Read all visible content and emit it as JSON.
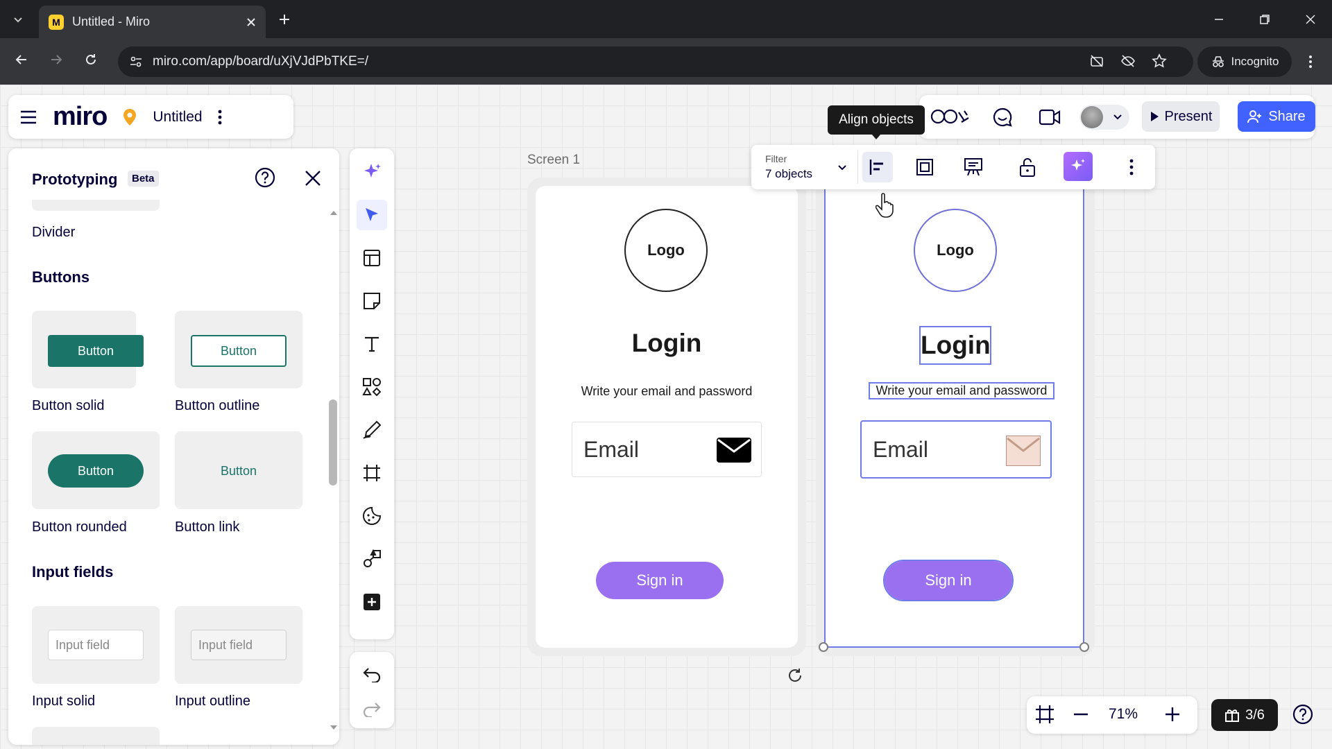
{
  "browser": {
    "tab_title": "Untitled - Miro",
    "url": "miro.com/app/board/uXjVJdPbTKE=/",
    "incognito_label": "Incognito"
  },
  "topbar": {
    "logo_text": "miro",
    "board_name": "Untitled",
    "present_label": "Present",
    "share_label": "Share"
  },
  "panel": {
    "title": "Prototyping",
    "badge": "Beta",
    "divider_caption": "Divider",
    "buttons_heading": "Buttons",
    "button_text": "Button",
    "captions": {
      "solid": "Button solid",
      "outline": "Button outline",
      "rounded": "Button rounded",
      "link": "Button link"
    },
    "inputs_heading": "Input fields",
    "input_text": "Input field",
    "input_captions": {
      "solid": "Input solid",
      "outline": "Input outline"
    }
  },
  "canvas": {
    "screen_label": "Screen 1",
    "logo_text": "Logo",
    "login_title": "Login",
    "subtitle": "Write your email and password",
    "email_placeholder": "Email",
    "signin_label": "Sign in"
  },
  "context_toolbar": {
    "filter_label": "Filter",
    "filter_value": "7 objects",
    "tooltip": "Align objects"
  },
  "zoom": {
    "level": "71%",
    "slides": "3/6"
  },
  "colors": {
    "brand_blue": "#4262ff",
    "button_green": "#1a7467",
    "signin_purple": "#9a6ff0",
    "selection": "#6f7be8"
  }
}
